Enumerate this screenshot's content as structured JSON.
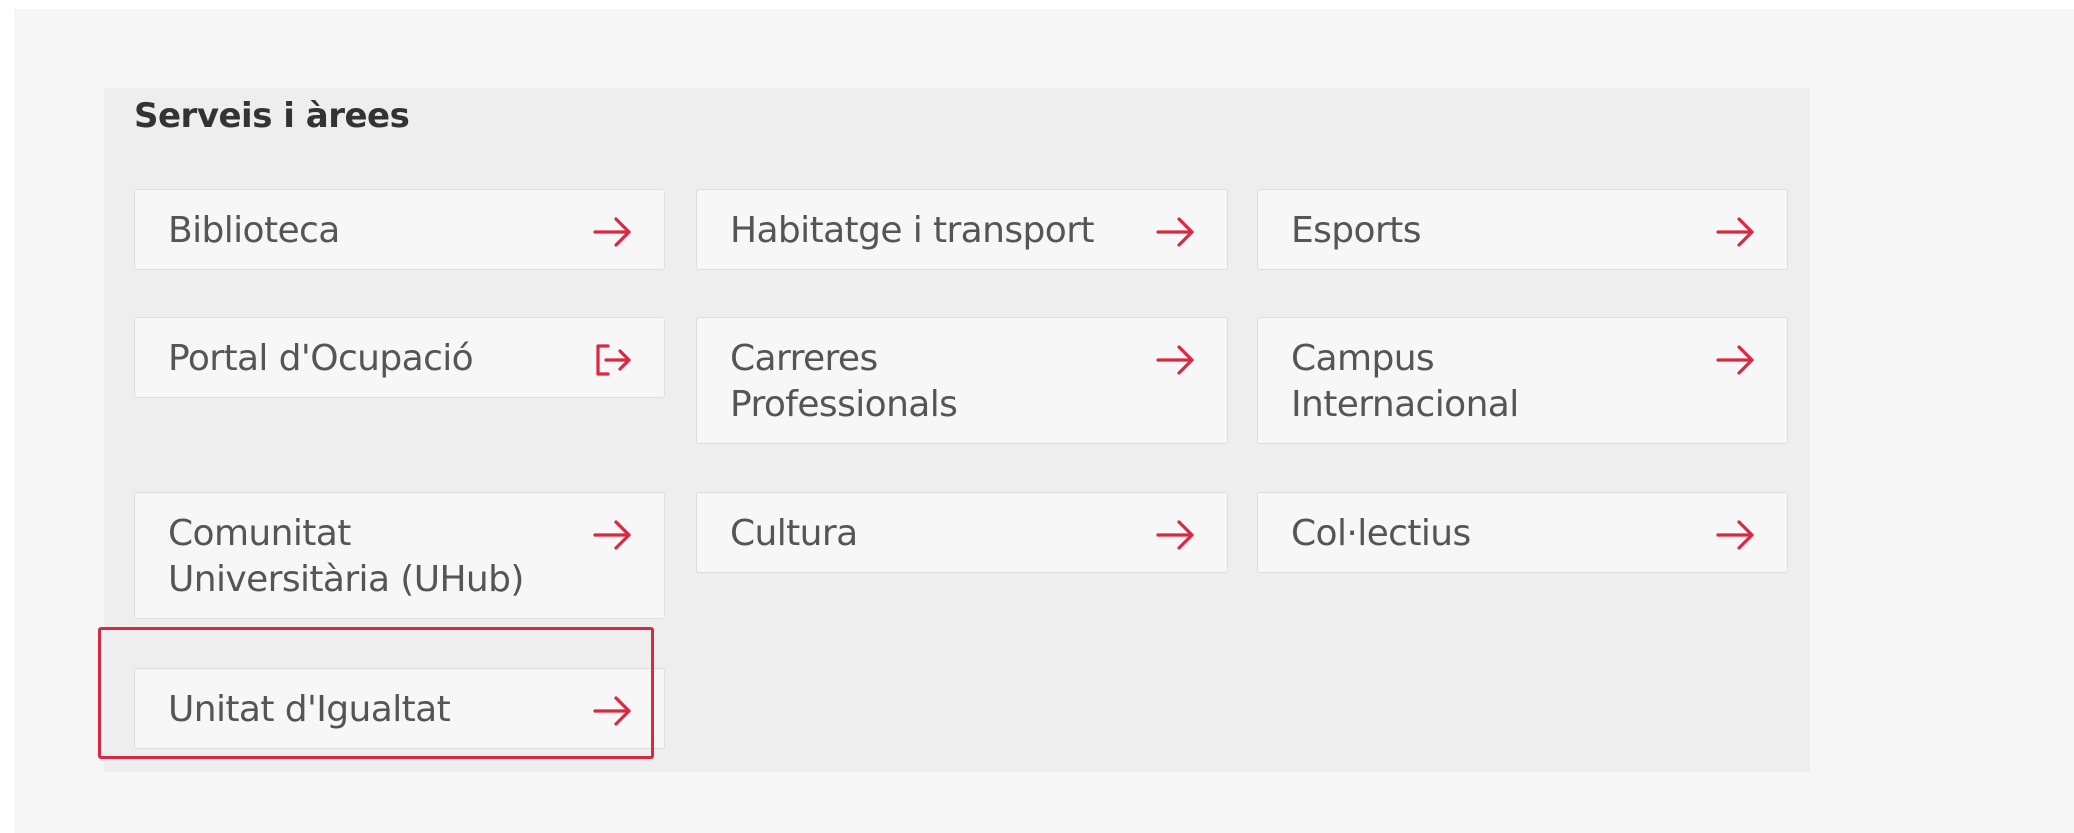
{
  "section": {
    "title": "Serveis i àrees"
  },
  "cards": [
    {
      "label": "Biblioteca",
      "icon": "arrow-right-icon"
    },
    {
      "label": "Habitatge i transport",
      "icon": "arrow-right-icon"
    },
    {
      "label": "Esports",
      "icon": "arrow-right-icon"
    },
    {
      "label": "Portal d'Ocupació",
      "icon": "external-link-icon"
    },
    {
      "label": "Carreres\nProfessionals",
      "icon": "arrow-right-icon"
    },
    {
      "label": "Campus\nInternacional",
      "icon": "arrow-right-icon"
    },
    {
      "label": "Comunitat\nUniversitària (UHub)",
      "icon": "arrow-right-icon"
    },
    {
      "label": "Cultura",
      "icon": "arrow-right-icon"
    },
    {
      "label": "Col·lectius",
      "icon": "arrow-right-icon"
    },
    {
      "label": "Unitat d'Igualtat",
      "icon": "arrow-right-icon"
    }
  ],
  "colors": {
    "accent": "#dc2743",
    "page_background": "#f6f6f6",
    "panel_background": "#eeeeee",
    "card_background": "#f7f7f7",
    "text": "#555555"
  }
}
